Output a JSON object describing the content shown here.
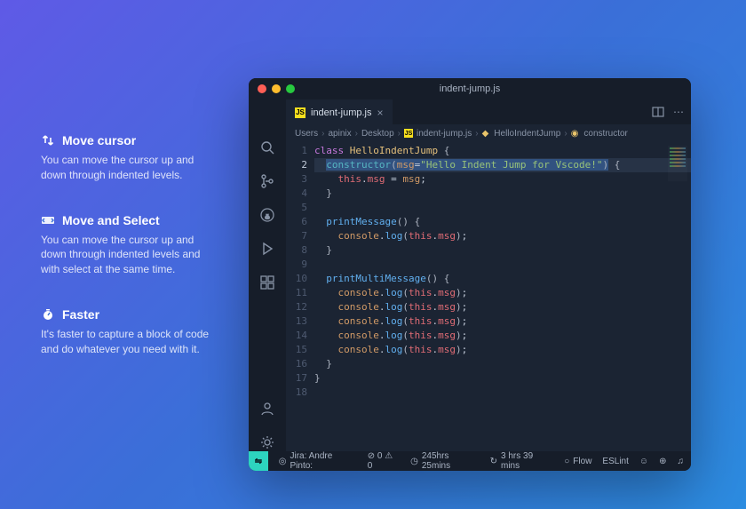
{
  "features": [
    {
      "icon": "arrows-up-down-icon",
      "title": "Move cursor",
      "desc": "You can move the cursor up and down through indented levels."
    },
    {
      "icon": "select-icon",
      "title": "Move and Select",
      "desc": "You can move the cursor up and down through indented levels and with select at the same time."
    },
    {
      "icon": "fast-icon",
      "title": "Faster",
      "desc": "It's faster to capture a block of code and do whatever you need with it."
    }
  ],
  "window": {
    "title": "indent-jump.js",
    "tab": {
      "label": "indent-jump.js"
    },
    "breadcrumb": [
      "Users",
      "apinix",
      "Desktop",
      "indent-jump.js",
      "HelloIndentJump",
      "constructor"
    ],
    "activity": [
      "files-icon",
      "search-icon",
      "source-control-icon",
      "github-icon",
      "run-icon",
      "extensions-icon"
    ],
    "activity_bottom": [
      "account-icon",
      "gear-icon"
    ],
    "gutter_lines": 18,
    "active_line": 2,
    "code": {
      "l1": {
        "pre": "",
        "kw": "class",
        "sp": " ",
        "cls": "HelloIndentJump",
        "sp2": " ",
        "br": "{"
      },
      "l2": {
        "pre": "  ",
        "fn": "constructor",
        "open": "(",
        "prm": "msg",
        "eq": "=",
        "str": "\"Hello Indent Jump for Vscode!\"",
        "close": ")",
        "sp": " ",
        "br": "{"
      },
      "l3": {
        "pre": "    ",
        "this": "this",
        "dot": ".",
        "prop": "msg",
        "sp": " ",
        "op": "=",
        "sp2": " ",
        "rhs": "msg",
        "semi": ";"
      },
      "l4": {
        "pre": "  ",
        "br": "}"
      },
      "l5": {
        "pre": ""
      },
      "l6": {
        "pre": "  ",
        "fn": "printMessage",
        "parens": "()",
        "sp": " ",
        "br": "{"
      },
      "l7": {
        "pre": "    ",
        "obj": "console",
        "dot": ".",
        "m": "log",
        "open": "(",
        "this": "this",
        "dot2": ".",
        "prop": "msg",
        "close": ")",
        "semi": ";"
      },
      "l8": {
        "pre": "  ",
        "br": "}"
      },
      "l9": {
        "pre": ""
      },
      "l10": {
        "pre": "  ",
        "fn": "printMultiMessage",
        "parens": "()",
        "sp": " ",
        "br": "{"
      },
      "l11": {
        "pre": "    ",
        "obj": "console",
        "dot": ".",
        "m": "log",
        "open": "(",
        "this": "this",
        "dot2": ".",
        "prop": "msg",
        "close": ")",
        "semi": ";"
      },
      "l12": {
        "pre": "    ",
        "obj": "console",
        "dot": ".",
        "m": "log",
        "open": "(",
        "this": "this",
        "dot2": ".",
        "prop": "msg",
        "close": ")",
        "semi": ";"
      },
      "l13": {
        "pre": "    ",
        "obj": "console",
        "dot": ".",
        "m": "log",
        "open": "(",
        "this": "this",
        "dot2": ".",
        "prop": "msg",
        "close": ")",
        "semi": ";"
      },
      "l14": {
        "pre": "    ",
        "obj": "console",
        "dot": ".",
        "m": "log",
        "open": "(",
        "this": "this",
        "dot2": ".",
        "prop": "msg",
        "close": ")",
        "semi": ";"
      },
      "l15": {
        "pre": "    ",
        "obj": "console",
        "dot": ".",
        "m": "log",
        "open": "(",
        "this": "this",
        "dot2": ".",
        "prop": "msg",
        "close": ")",
        "semi": ";"
      },
      "l16": {
        "pre": "  ",
        "br": "}"
      },
      "l17": {
        "pre": "",
        "br": "}"
      },
      "l18": {
        "pre": ""
      }
    },
    "status": {
      "jira": "Jira: Andre Pinto:",
      "warn_err": "⊘ 0 ⚠ 0",
      "total": "245hrs 25mins",
      "session": "3 hrs 39 mins",
      "flow": "Flow",
      "eslint": "ESLint"
    }
  }
}
